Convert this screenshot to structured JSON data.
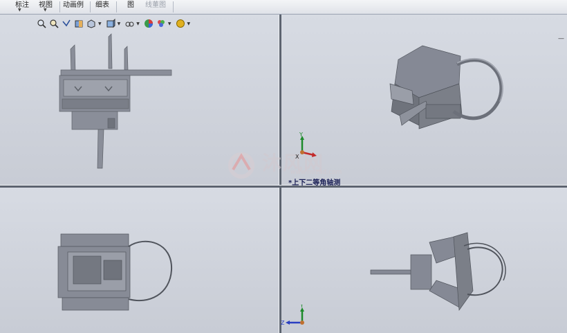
{
  "toolbar": {
    "items": [
      {
        "label": "标注"
      },
      {
        "label": "视图"
      },
      {
        "label": "动画例"
      },
      {
        "label": "细表"
      },
      {
        "label": "图"
      },
      {
        "label": "线董图"
      }
    ]
  },
  "viewports": {
    "top_right": {
      "view_label": "*上下二等角轴测"
    }
  },
  "triads": {
    "top_right": {
      "y": "Y",
      "x": "X"
    },
    "bottom_right": {
      "y": "Y",
      "z": "Z"
    }
  },
  "watermark": {
    "text": "沐风网",
    "url": "www.mfcad.com"
  },
  "hud_icons": [
    "zoom-to-fit-icon",
    "zoom-area-icon",
    "previous-view-icon",
    "section-view-icon",
    "view-orientation-icon",
    "display-style-icon",
    "hide-show-icon",
    "edit-appearance-icon",
    "apply-scene-icon",
    "view-settings-icon"
  ],
  "colors": {
    "model": "#8a8e99",
    "background": "#cfd3db",
    "label": "#1a1f55"
  }
}
